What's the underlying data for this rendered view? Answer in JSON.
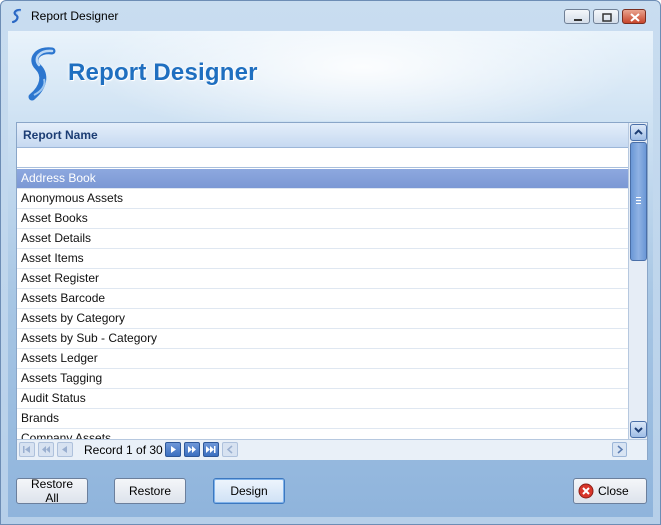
{
  "window": {
    "title": "Report Designer"
  },
  "banner": {
    "title": "Report Designer"
  },
  "grid": {
    "column_header": "Report Name",
    "filter_value": "",
    "rows": [
      "Address Book",
      "Anonymous Assets",
      "Asset Books",
      "Asset Details",
      "Asset Items",
      "Asset Register",
      "Assets Barcode",
      "Assets by Category",
      "Assets by Sub - Category",
      "Assets Ledger",
      "Assets Tagging",
      "Audit Status",
      "Brands",
      "Company Assets"
    ],
    "selected_index": 0,
    "record_text": "Record 1 of 30"
  },
  "buttons": {
    "restore_all": "Restore All",
    "restore": "Restore",
    "design": "Design",
    "close": "Close"
  },
  "colors": {
    "accent": "#1f6fc0",
    "selection": "#7b98d4"
  }
}
